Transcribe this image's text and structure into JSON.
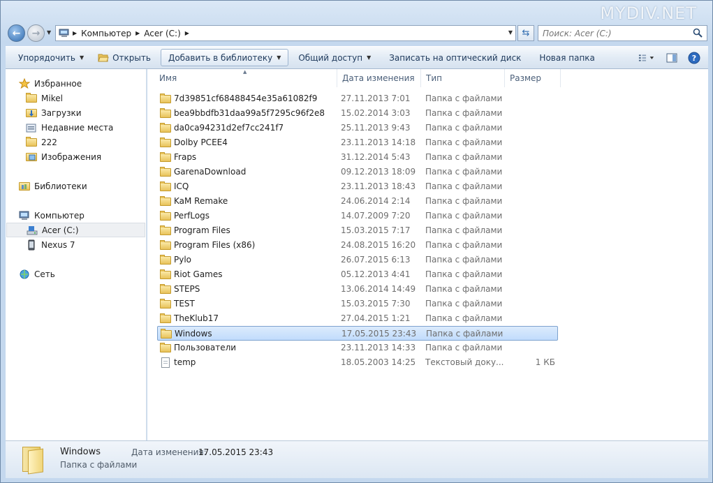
{
  "watermark": "MYDIV.NET",
  "address": {
    "crumbs": [
      "Компьютер",
      "Acer (C:)"
    ]
  },
  "search": {
    "placeholder": "Поиск: Acer (C:)"
  },
  "toolbar": {
    "organize": "Упорядочить",
    "open": "Открыть",
    "add_to_library": "Добавить в библиотеку",
    "share": "Общий доступ",
    "burn": "Записать на оптический диск",
    "new_folder": "Новая папка"
  },
  "nav": {
    "favorites": "Избранное",
    "items_favorites": [
      "Mikel",
      "Загрузки",
      "Недавние места",
      "222",
      "Изображения"
    ],
    "libraries": "Библиотеки",
    "computer": "Компьютер",
    "items_computer": [
      "Acer (C:)",
      "Nexus 7"
    ],
    "network": "Сеть"
  },
  "columns": {
    "name": "Имя",
    "date": "Дата изменения",
    "type": "Тип",
    "size": "Размер"
  },
  "files": [
    {
      "name": "7d39851cf68488454e35a61082f9",
      "date": "27.11.2013 7:01",
      "type": "Папка с файлами",
      "size": ""
    },
    {
      "name": "bea9bbdfb31daa99a5f7295c96f2e8",
      "date": "15.02.2014 3:03",
      "type": "Папка с файлами",
      "size": ""
    },
    {
      "name": "da0ca94231d2ef7cc241f7",
      "date": "25.11.2013 9:43",
      "type": "Папка с файлами",
      "size": ""
    },
    {
      "name": "Dolby PCEE4",
      "date": "23.11.2013 14:18",
      "type": "Папка с файлами",
      "size": ""
    },
    {
      "name": "Fraps",
      "date": "31.12.2014 5:43",
      "type": "Папка с файлами",
      "size": ""
    },
    {
      "name": "GarenaDownload",
      "date": "09.12.2013 18:09",
      "type": "Папка с файлами",
      "size": ""
    },
    {
      "name": "ICQ",
      "date": "23.11.2013 18:43",
      "type": "Папка с файлами",
      "size": ""
    },
    {
      "name": "KaM Remake",
      "date": "24.06.2014 2:14",
      "type": "Папка с файлами",
      "size": ""
    },
    {
      "name": "PerfLogs",
      "date": "14.07.2009 7:20",
      "type": "Папка с файлами",
      "size": ""
    },
    {
      "name": "Program Files",
      "date": "15.03.2015 7:17",
      "type": "Папка с файлами",
      "size": ""
    },
    {
      "name": "Program Files (x86)",
      "date": "24.08.2015 16:20",
      "type": "Папка с файлами",
      "size": ""
    },
    {
      "name": "Pylo",
      "date": "26.07.2015 6:13",
      "type": "Папка с файлами",
      "size": ""
    },
    {
      "name": "Riot Games",
      "date": "05.12.2013 4:41",
      "type": "Папка с файлами",
      "size": ""
    },
    {
      "name": "STEPS",
      "date": "13.06.2014 14:49",
      "type": "Папка с файлами",
      "size": ""
    },
    {
      "name": "TEST",
      "date": "15.03.2015 7:30",
      "type": "Папка с файлами",
      "size": ""
    },
    {
      "name": "TheKlub17",
      "date": "27.04.2015 1:21",
      "type": "Папка с файлами",
      "size": ""
    },
    {
      "name": "Windows",
      "date": "17.05.2015 23:43",
      "type": "Папка с файлами",
      "size": "",
      "selected": true
    },
    {
      "name": "Пользователи",
      "date": "23.11.2013 14:33",
      "type": "Папка с файлами",
      "size": ""
    },
    {
      "name": "temp",
      "date": "18.05.2003 14:25",
      "type": "Текстовый доку...",
      "size": "1 КБ",
      "kind": "doc"
    }
  ],
  "details": {
    "name": "Windows",
    "type": "Папка с файлами",
    "date_label": "Дата изменения:",
    "date_value": "17.05.2015 23:43"
  }
}
